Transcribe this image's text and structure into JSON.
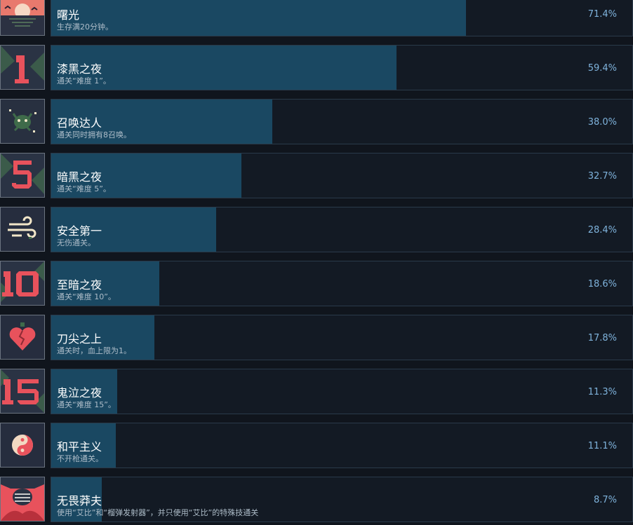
{
  "achievements": [
    {
      "title": "曙光",
      "desc": "生存满20分钟。",
      "percent": "71.4%",
      "fill": 0.714,
      "icon": "sunrise-icon"
    },
    {
      "title": "漆黑之夜",
      "desc": "通关“难度 1”。",
      "percent": "59.4%",
      "fill": 0.594,
      "icon": "difficulty-1-icon"
    },
    {
      "title": "召唤达人",
      "desc": "通关同时拥有8召唤。",
      "percent": "38.0%",
      "fill": 0.38,
      "icon": "summon-creature-icon"
    },
    {
      "title": "暗黑之夜",
      "desc": "通关“难度 5”。",
      "percent": "32.7%",
      "fill": 0.327,
      "icon": "difficulty-5-icon"
    },
    {
      "title": "安全第一",
      "desc": "无伤通关。",
      "percent": "28.4%",
      "fill": 0.284,
      "icon": "wind-swirl-icon"
    },
    {
      "title": "至暗之夜",
      "desc": "通关“难度 10”。",
      "percent": "18.6%",
      "fill": 0.186,
      "icon": "difficulty-10-icon"
    },
    {
      "title": "刀尖之上",
      "desc": "通关时，血上限为1。",
      "percent": "17.8%",
      "fill": 0.178,
      "icon": "cracked-heart-icon"
    },
    {
      "title": "鬼泣之夜",
      "desc": "通关“难度 15”。",
      "percent": "11.3%",
      "fill": 0.113,
      "icon": "difficulty-15-icon"
    },
    {
      "title": "和平主义",
      "desc": "不开枪通关。",
      "percent": "11.1%",
      "fill": 0.111,
      "icon": "yin-yang-icon"
    },
    {
      "title": "无畏莽夫",
      "desc": "使用“艾比”和“榴弹发射器”，并只使用“艾比”的特殊技通关",
      "percent": "8.7%",
      "fill": 0.087,
      "icon": "armored-creature-icon"
    }
  ]
}
